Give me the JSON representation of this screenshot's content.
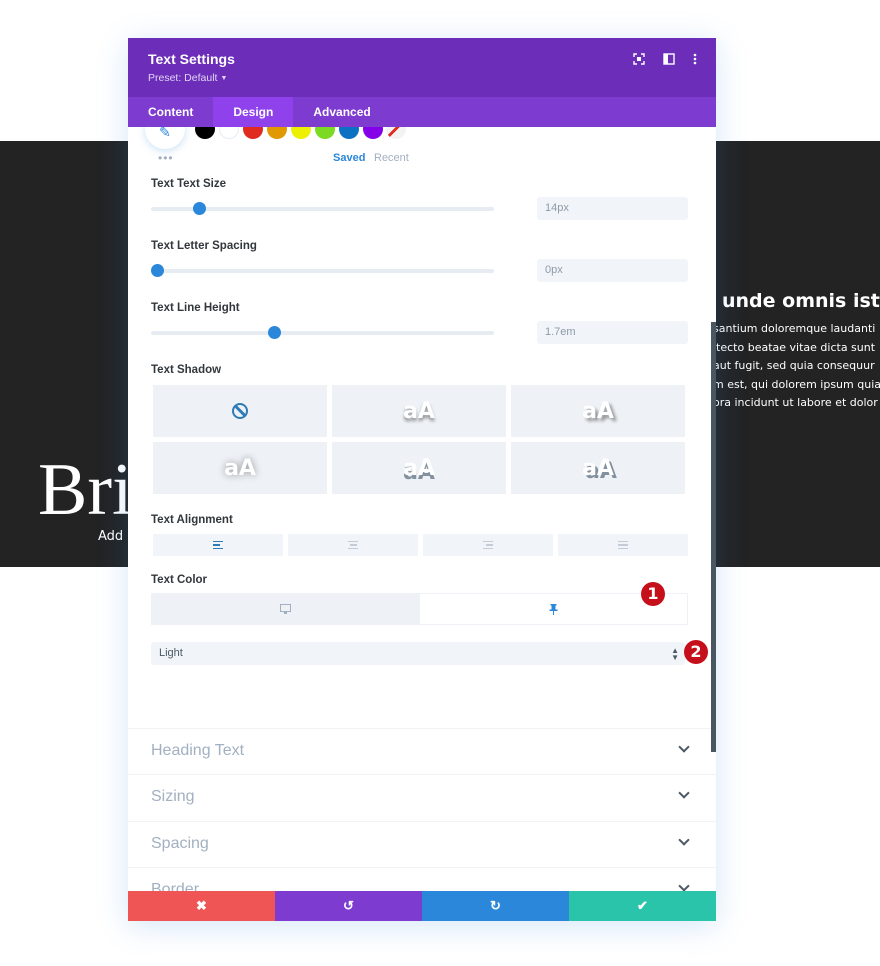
{
  "background": {
    "heading": "unde omnis iste",
    "paragraph_lines": [
      "santium doloremque laudanti",
      "itecto beatae vitae dicta sunt",
      " aut fugit, sed quia consequur",
      "m est, qui dolorem ipsum quia",
      "ora incidunt ut labore et dolor"
    ],
    "big_text": "Bri",
    "sub_text": "Add"
  },
  "modal": {
    "title": "Text Settings",
    "preset": "Preset: Default",
    "header_icons": [
      "fullscreen-icon",
      "split-view-icon",
      "more-options-icon"
    ],
    "tabs": [
      {
        "label": "Content",
        "active": false
      },
      {
        "label": "Design",
        "active": true
      },
      {
        "label": "Advanced",
        "active": false
      }
    ]
  },
  "color_picker": {
    "swatches": [
      "#000000",
      "#ffffff",
      "#e02b20",
      "#e09900",
      "#edf000",
      "#7cda24",
      "#0c71c3",
      "#8300e9"
    ],
    "saved_label": "Saved",
    "recent_label": "Recent",
    "more_label": "•••"
  },
  "settings": {
    "text_size": {
      "label": "Text Text Size",
      "value": "14px",
      "slider_fraction": 0.14
    },
    "letter_spacing": {
      "label": "Text Letter Spacing",
      "value": "0px",
      "slider_fraction": 0.0
    },
    "line_height": {
      "label": "Text Line Height",
      "value": "1.7em",
      "slider_fraction": 0.36
    },
    "text_shadow": {
      "label": "Text Shadow",
      "options": [
        "none",
        "aA",
        "aA",
        "aA",
        "aA",
        "aA"
      ],
      "selected": 0
    },
    "text_alignment": {
      "label": "Text Alignment",
      "options": [
        "left",
        "center",
        "right",
        "justify"
      ],
      "selected": 0
    },
    "text_color": {
      "label": "Text Color",
      "options": [
        "desktop",
        "hover-pin"
      ],
      "selected": 1,
      "select_value": "Light"
    }
  },
  "badges": [
    "1",
    "2"
  ],
  "sections": [
    "Heading Text",
    "Sizing",
    "Spacing",
    "Border"
  ],
  "footer": {
    "buttons": [
      {
        "name": "cancel",
        "glyph": "✖",
        "color": "#ef5555"
      },
      {
        "name": "undo",
        "glyph": "↺",
        "color": "#7e3bd0"
      },
      {
        "name": "redo",
        "glyph": "↻",
        "color": "#2b87da"
      },
      {
        "name": "save",
        "glyph": "✔",
        "color": "#29c4a9"
      }
    ]
  }
}
